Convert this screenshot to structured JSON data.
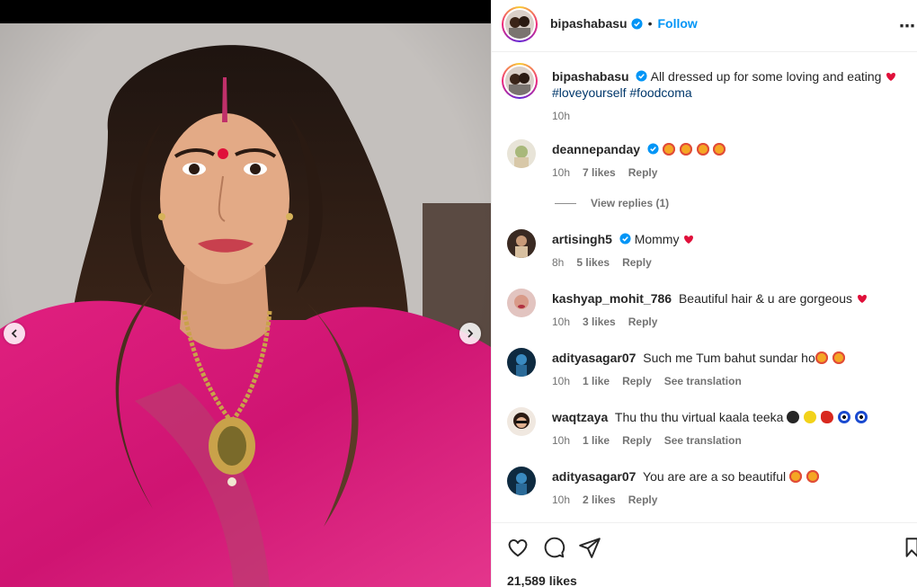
{
  "post": {
    "author": "bipashabasu",
    "follow_label": "Follow",
    "separator": "•",
    "more_label": "⋯",
    "caption": {
      "username": "bipashabasu",
      "text": "All dressed up for some loving and eating",
      "hashtags": [
        "#loveyourself",
        "#foodcoma"
      ],
      "time": "10h"
    },
    "likes": "21,589 likes"
  },
  "comments": [
    {
      "username": "deannepanday",
      "verified": true,
      "text": "",
      "emojis": [
        "star-eyes",
        "star-eyes",
        "star-eyes",
        "star-eyes"
      ],
      "time": "10h",
      "likes": "7 likes",
      "reply": "Reply",
      "view_replies": "View replies (1)"
    },
    {
      "username": "artisingh5",
      "verified": true,
      "text": "Mommy",
      "emojis": [
        "heart"
      ],
      "time": "8h",
      "likes": "5 likes",
      "reply": "Reply"
    },
    {
      "username": "kashyap_mohit_786",
      "verified": false,
      "text": "Beautiful hair & u are gorgeous",
      "emojis": [
        "heart"
      ],
      "time": "10h",
      "likes": "3 likes",
      "reply": "Reply"
    },
    {
      "username": "adityasagar07",
      "verified": false,
      "text": "Such me Tum bahut sundar ho",
      "emojis": [
        "star-eyes",
        "star-eyes"
      ],
      "time": "10h",
      "likes": "1 like",
      "reply": "Reply",
      "translate": "See translation"
    },
    {
      "username": "waqtzaya",
      "verified": false,
      "text": "Thu thu thu virtual kaala teeka",
      "emojis": [
        "black-circle",
        "lemon",
        "chili",
        "nazar",
        "nazar"
      ],
      "time": "10h",
      "likes": "1 like",
      "reply": "Reply",
      "translate": "See translation"
    },
    {
      "username": "adityasagar07",
      "verified": false,
      "text": "You are are a so beautiful",
      "emojis": [
        "star-eyes",
        "star-eyes"
      ],
      "time": "10h",
      "likes": "2 likes",
      "reply": "Reply"
    }
  ],
  "colors": {
    "link_blue": "#0095f6",
    "hashtag": "#00376b",
    "secondary_text": "#737373",
    "saree_pink": "#d61a7a",
    "bindi_red": "#e0103a"
  },
  "icons": {
    "carousel_prev": "chevron-left-icon",
    "carousel_next": "chevron-right-icon",
    "like": "heart-outline-icon",
    "comment": "speech-bubble-icon",
    "share": "paper-plane-icon",
    "save": "bookmark-icon"
  }
}
